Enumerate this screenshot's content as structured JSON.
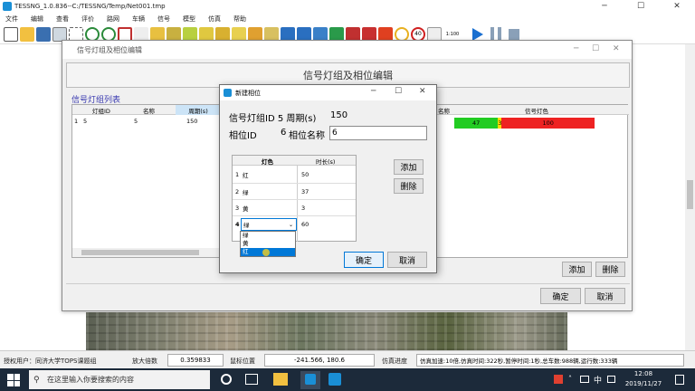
{
  "app": {
    "title": "TESSNG_1.0.836--C:/TESSNG/Temp/Net001.tmp"
  },
  "menu": [
    "文件",
    "编辑",
    "查看",
    "评价",
    "路网",
    "车辆",
    "信号",
    "模型",
    "仿真",
    "帮助"
  ],
  "toolbar": {
    "icons": [
      "new-file-icon",
      "open-folder-icon",
      "save-icon",
      "grid-icon",
      "select-icon",
      "zoom-in-icon",
      "zoom-out-icon",
      "fit-icon",
      "pointer-icon",
      "road-icon",
      "road-icon",
      "road-icon",
      "road-icon",
      "road-icon",
      "road-icon",
      "marker-icon",
      "marker-icon",
      "bus-icon",
      "bus-icon",
      "bus-stop-icon",
      "arrow-icon",
      "signal-icon",
      "parking-icon",
      "vehicle-icon",
      "speed-icon",
      "limit-icon",
      "menu-icon",
      "scale-icon",
      "play-icon",
      "pause-icon",
      "stop-icon"
    ],
    "scale_label": "1:100",
    "limit_label": "40"
  },
  "main_dialog": {
    "title": "信号灯组及相位编辑",
    "header": "信号灯组及相位编辑",
    "group_list_title": "信号灯组列表",
    "group_table": {
      "headers": [
        "灯组ID",
        "名称",
        "周期(s)"
      ],
      "rows": [
        {
          "index": "1",
          "id": "5",
          "name": "5",
          "period": "150"
        }
      ]
    },
    "phase_table": {
      "headers": [
        "名称",
        "信号灯色"
      ],
      "segments": [
        {
          "label": "47",
          "color": "#22cc22"
        },
        {
          "label": "3",
          "color": "#ffdd00"
        },
        {
          "label": "100",
          "color": "#ee2222"
        }
      ]
    },
    "add_label": "添加",
    "delete_label": "删除",
    "ok_label": "确定",
    "cancel_label": "取消"
  },
  "phase_dialog": {
    "title": "新建相位",
    "group_line": "信号灯组ID 5 周期(s)",
    "period_value": "150",
    "phase_id_label": "相位ID",
    "phase_id_value": "6",
    "phase_name_label": "相位名称",
    "phase_name_value": "6",
    "table_headers": [
      "灯色",
      "时长(s)"
    ],
    "rows": [
      {
        "index": "1",
        "color": "红",
        "duration": "50"
      },
      {
        "index": "2",
        "color": "绿",
        "duration": "37"
      },
      {
        "index": "3",
        "color": "黄",
        "duration": "3"
      },
      {
        "index": "4",
        "color": "绿",
        "duration": "60"
      }
    ],
    "dropdown_options": [
      "绿",
      "黄",
      "红"
    ],
    "add_label": "添加",
    "delete_label": "删除",
    "ok_label": "确定",
    "cancel_label": "取消"
  },
  "statusbar": {
    "user": "授权用户：同济大学TOPS课题组",
    "zoom_label": "放大倍数",
    "zoom_value": "0.359833",
    "mouse_label": "鼠标位置",
    "mouse_value": "-241.566, 180.6",
    "progress_label": "仿真进度",
    "sim_info": "仿真加速:10倍,仿真时间:322秒,暂停时间:1秒,总车数:988辆,运行数:333辆"
  },
  "taskbar": {
    "search_placeholder": "在这里输入你要搜索的内容",
    "ime": "中",
    "time": "12:08",
    "date": "2019/11/27"
  }
}
